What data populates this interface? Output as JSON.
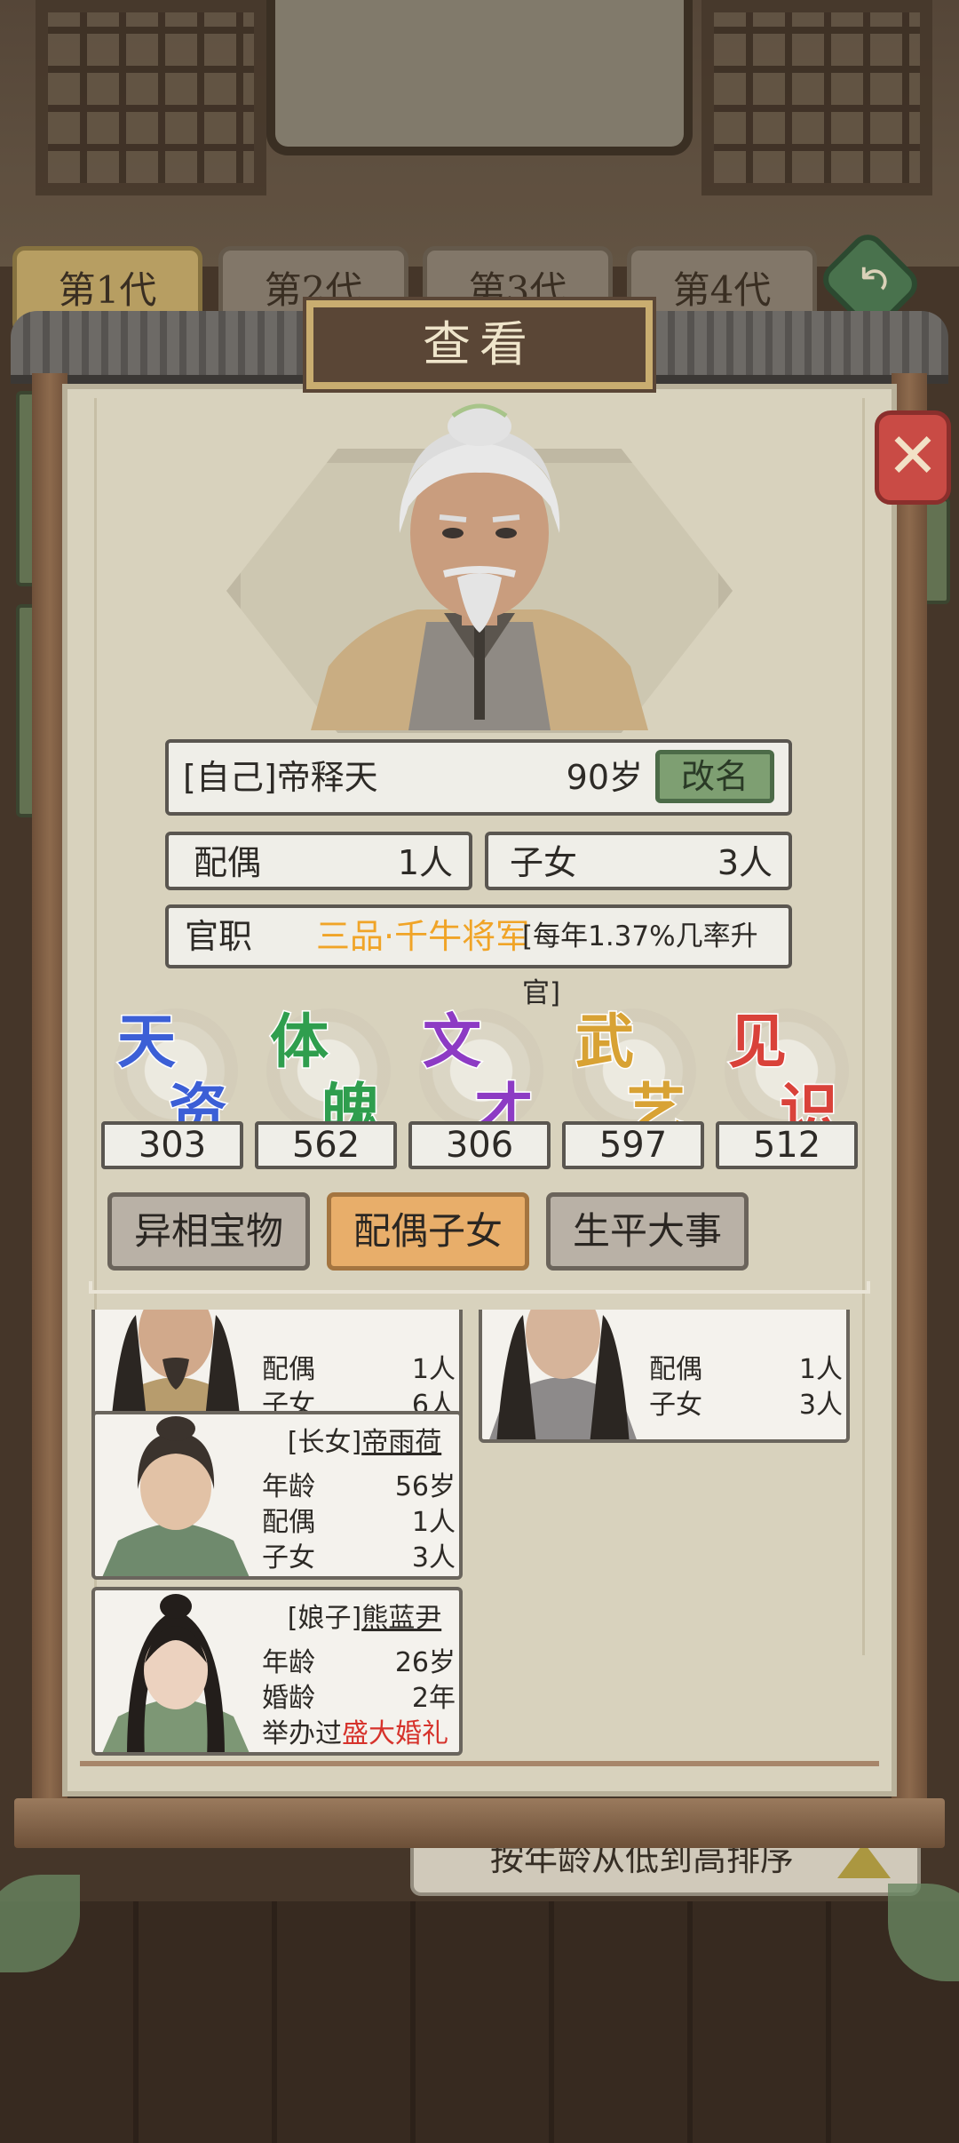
{
  "generation_tabs": [
    "第1代",
    "第2代",
    "第3代",
    "第4代"
  ],
  "modal_title": "查看",
  "profile": {
    "name": "[自己]帝释天",
    "age": "90岁",
    "rename_label": "改名",
    "spouse_label": "配偶",
    "spouse_value": "1人",
    "children_label": "子女",
    "children_value": "3人",
    "office_label": "官职",
    "office_title": "三品·千牛将军",
    "office_rate": "[每年1.37%几率升官]"
  },
  "attributes": [
    {
      "c1": "天",
      "c2": "资",
      "value": "303",
      "color": "#3c5fd6"
    },
    {
      "c1": "体",
      "c2": "魄",
      "value": "562",
      "color": "#2f9e4e"
    },
    {
      "c1": "文",
      "c2": "才",
      "value": "306",
      "color": "#8d3bc4"
    },
    {
      "c1": "武",
      "c2": "艺",
      "value": "597",
      "color": "#d8a234"
    },
    {
      "c1": "见",
      "c2": "识",
      "value": "512",
      "color": "#d9423a"
    }
  ],
  "tabs": [
    "异相宝物",
    "配偶子女",
    "生平大事"
  ],
  "family": {
    "card1": {
      "spouse_label": "配偶",
      "spouse_value": "1人",
      "children_label": "子女",
      "children_value": "6人"
    },
    "card2": {
      "spouse_label": "配偶",
      "spouse_value": "1人",
      "children_label": "子女",
      "children_value": "3人"
    },
    "card3": {
      "role": "[长女]",
      "name": "帝雨荷",
      "age_label": "年龄",
      "age_value": "56岁",
      "spouse_label": "配偶",
      "spouse_value": "1人",
      "children_label": "子女",
      "children_value": "3人"
    },
    "card4": {
      "role": "[娘子]",
      "name": "熊蓝尹",
      "age_label": "年龄",
      "age_value": "26岁",
      "marriage_label": "婚龄",
      "marriage_value": "2年",
      "wedding_prefix": "举办过",
      "wedding_type": "盛大婚礼"
    }
  },
  "sort_label": "按年龄从低到高排序",
  "icons": {
    "close": "close-x-icon",
    "back": "back-arrow-icon",
    "sort": "sort-triangle-icon"
  }
}
